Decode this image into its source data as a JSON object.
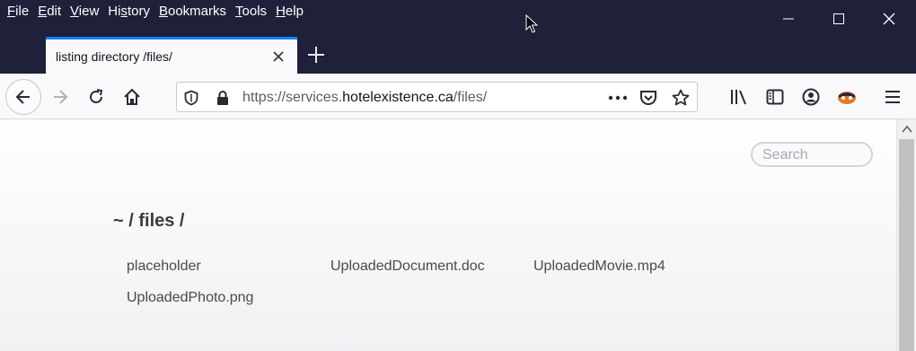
{
  "menu": [
    {
      "pre": "",
      "ul": "F",
      "post": "ile"
    },
    {
      "pre": "",
      "ul": "E",
      "post": "dit"
    },
    {
      "pre": "",
      "ul": "V",
      "post": "iew"
    },
    {
      "pre": "Hi",
      "ul": "s",
      "post": "tory"
    },
    {
      "pre": "",
      "ul": "B",
      "post": "ookmarks"
    },
    {
      "pre": "",
      "ul": "T",
      "post": "ools"
    },
    {
      "pre": "",
      "ul": "H",
      "post": "elp"
    }
  ],
  "tab": {
    "title": "listing directory /files/"
  },
  "url": {
    "scheme": "https://services.",
    "host": "hotelexistence.ca",
    "path": "/files/"
  },
  "search": {
    "placeholder": "Search"
  },
  "breadcrumb": "~ / files /",
  "files": [
    "placeholder",
    "UploadedDocument.doc",
    "UploadedMovie.mp4",
    "UploadedPhoto.png"
  ],
  "icons": {
    "back": "back-arrow-icon",
    "forward": "forward-arrow-icon",
    "reload": "reload-icon",
    "home": "home-icon",
    "shield": "shield-icon",
    "lock": "lock-icon",
    "more": "more-icon",
    "pocket": "pocket-icon",
    "star": "star-icon",
    "library": "library-icon",
    "sidebar": "sidebar-icon",
    "account": "account-icon",
    "extension": "extension-icon",
    "menu": "hamburger-menu-icon"
  },
  "colors": {
    "chrome": "#1f2039",
    "tab_accent": "#0a84ff",
    "toolbar": "#f9f9fb"
  }
}
